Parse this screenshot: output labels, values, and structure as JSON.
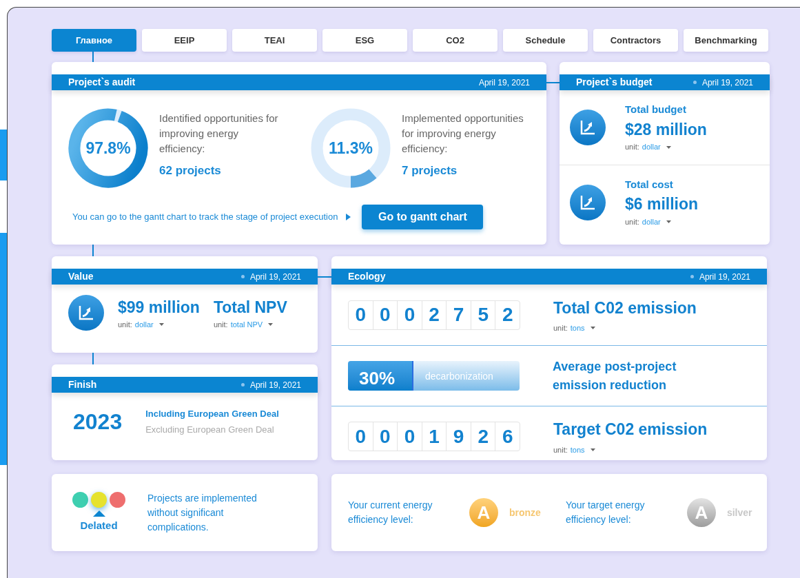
{
  "tabs": [
    {
      "label": "Главное",
      "selected": true
    },
    {
      "label": "EEIP",
      "selected": false
    },
    {
      "label": "TEAI",
      "selected": false
    },
    {
      "label": "ESG",
      "selected": false
    },
    {
      "label": "CO2",
      "selected": false
    },
    {
      "label": "Schedule",
      "selected": false
    },
    {
      "label": "Contractors",
      "selected": false
    },
    {
      "label": "Benchmarking",
      "selected": false
    }
  ],
  "audit": {
    "title": "Project`s audit",
    "date": "April 19, 2021",
    "donuts": [
      {
        "value": "97.8%",
        "text": "Identified opportunities for improving energy efficiency:",
        "count": "62 projects"
      },
      {
        "value": "11.3%",
        "text": "Implemented opportunities for improving energy efficiency:",
        "count": "7 projects"
      }
    ],
    "hint": "You can go to the gantt chart to track the stage of project execution",
    "button": "Go to gantt chart"
  },
  "budget": {
    "title": "Project`s budget",
    "date": "April 19, 2021",
    "items": [
      {
        "label": "Total budget",
        "amount": "$28 million",
        "unit_label": "unit:",
        "unit": "dollar"
      },
      {
        "label": "Total cost",
        "amount": "$6 million",
        "unit_label": "unit:",
        "unit": "dollar"
      }
    ]
  },
  "value": {
    "title": "Value",
    "date": "April 19, 2021",
    "amount": "$99 million",
    "unit_label": "unit:",
    "unit": "dollar",
    "npv": "Total NPV",
    "npv_unit_label": "unit:",
    "npv_unit": "total NPV"
  },
  "finish": {
    "title": "Finish",
    "date": "April 19, 2021",
    "year": "2023",
    "options": [
      {
        "label": "Including European Green Deal",
        "selected": true
      },
      {
        "label": "Excluding European Green Deal",
        "selected": false
      }
    ]
  },
  "ecology": {
    "title": "Ecology",
    "date": "April 19, 2021",
    "rows": [
      {
        "kind": "counter",
        "digits": [
          "0",
          "0",
          "0",
          "2",
          "7",
          "5",
          "2"
        ],
        "label": "Total C02 emission",
        "unit_label": "unit:",
        "unit": "tons"
      },
      {
        "kind": "bar",
        "value": "30%",
        "bar_label": "decarbonization",
        "level": 0.38,
        "label": "Average post-project emission reduction"
      },
      {
        "kind": "counter",
        "digits": [
          "0",
          "0",
          "0",
          "1",
          "9",
          "2",
          "6"
        ],
        "label": "Target C02 emission",
        "unit_label": "unit:",
        "unit": "tons"
      }
    ]
  },
  "status": {
    "lights": [
      {
        "color": "#3ecfb0",
        "selected": false
      },
      {
        "color": "#e6e22e",
        "selected": true
      },
      {
        "color": "#ee6e6e",
        "selected": false
      }
    ],
    "label": "Delated",
    "text": "Projects are implemented without significant complications."
  },
  "levels": [
    {
      "caption": "Your current energy efficiency level:",
      "letter": "A",
      "kind": "bronze",
      "name": "bronze"
    },
    {
      "caption": "Your target energy efficiency level:",
      "letter": "A",
      "kind": "silver",
      "name": "silver"
    }
  ]
}
